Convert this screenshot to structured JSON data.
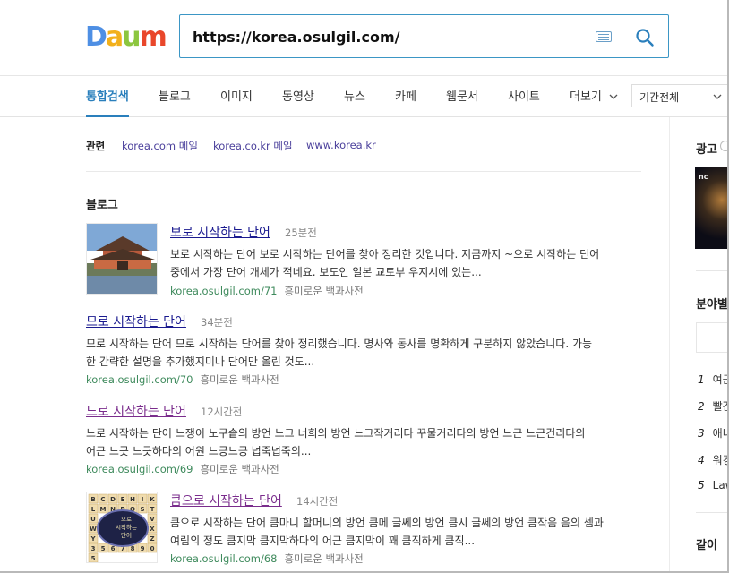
{
  "logo": {
    "letters": [
      "D",
      "a",
      "u",
      "m"
    ],
    "colors": [
      "#4e8fe4",
      "#f2b01b",
      "#8cc63f",
      "#e9472b"
    ]
  },
  "search": {
    "query": "https://korea.osulgil.com/"
  },
  "icons": {
    "keyboard": "keyboard-icon",
    "search": "search-icon",
    "dropdown": "chevron-down-icon"
  },
  "tabs": [
    {
      "label": "통합검색",
      "active": true
    },
    {
      "label": "블로그"
    },
    {
      "label": "이미지"
    },
    {
      "label": "동영상"
    },
    {
      "label": "뉴스"
    },
    {
      "label": "카페"
    },
    {
      "label": "웹문서"
    },
    {
      "label": "사이트"
    },
    {
      "label": "더보기"
    }
  ],
  "period_filter": "기간전체",
  "related": {
    "label": "관련",
    "links": [
      "korea.com 메일",
      "korea.co.kr 메일",
      "www.korea.kr"
    ]
  },
  "blog_section": {
    "title": "블로그",
    "results": [
      {
        "title": "보로 시작하는 단어",
        "time": "25분전",
        "snippet_lines": [
          "보로 시작하는 단어 보로 시작하는 단어를 찾아 정리한 것입니다. 지금까지 ~으로 시작하는 단어",
          "중에서 가장 단어 개체가 적네요. 보도인 일본 교토부 우지시에 있는..."
        ],
        "url": "korea.osulgil.com/71",
        "category": "흥미로운 백과사전",
        "thumbnail": "temple-image"
      },
      {
        "title": "므로 시작하는 단어",
        "time": "34분전",
        "snippet_lines": [
          "므로 시작하는 단어 므로 시작하는 단어를 찾아 정리했습니다. 명사와 동사를 명확하게 구분하지 않았습니다. 가능",
          "한 간략한 설명을 추가했지미나 단어만 올린 것도..."
        ],
        "url": "korea.osulgil.com/70",
        "category": "흥미로운 백과사전"
      },
      {
        "title": "느로 시작하는 단어",
        "time": "12시간전",
        "snippet_lines": [
          "느로 시작하는 단어 느쟁이 노구솥의 방언 느그 너희의 방언 느그작거리다 꾸물거리다의 방언 느근 느근건리다의",
          "어근 느긋 느긋하다의 어원 느긍느긍 넙죽넙죽의..."
        ],
        "url": "korea.osulgil.com/69",
        "category": "흥미로운 백과사전",
        "visited": true
      },
      {
        "title": "큼으로 시작하는 단어",
        "time": "14시간전",
        "snippet_lines": [
          "큼으로 시작하는 단어 큼마니 할머니의 방언 큼메 글쎄의 방언 큼시 글쎄의 방언 큼작음 음의 셈과",
          "여림의 정도 큼지막 큼지막하다의 어근 큼지막이 꽤 큼직하게 큼직..."
        ],
        "url": "korea.osulgil.com/68",
        "category": "흥미로운 백과사전",
        "visited": true,
        "thumbnail": "letter-tiles-image",
        "thumb_overlay": [
          "으로",
          "시작하는",
          "단어"
        ],
        "thumb_tiles": [
          "B",
          "C",
          "D",
          "E",
          "H",
          "I",
          "K",
          "L",
          "M",
          "N",
          "P",
          "Q",
          "S",
          "T",
          "U",
          "V",
          "W",
          "X",
          "Y",
          "Z",
          "3",
          "5",
          "6",
          "7",
          "8",
          "9",
          "0",
          "5"
        ]
      }
    ]
  },
  "sidebar": {
    "ad_title": "광고",
    "ad_brand": "nc",
    "category_title": "분야별",
    "ranking": [
      {
        "num": "1",
        "text": "여근"
      },
      {
        "num": "2",
        "text": "빨간"
      },
      {
        "num": "3",
        "text": "애니"
      },
      {
        "num": "4",
        "text": "워킹"
      },
      {
        "num": "5",
        "text": "Law"
      }
    ],
    "bottom_title": "같이"
  }
}
